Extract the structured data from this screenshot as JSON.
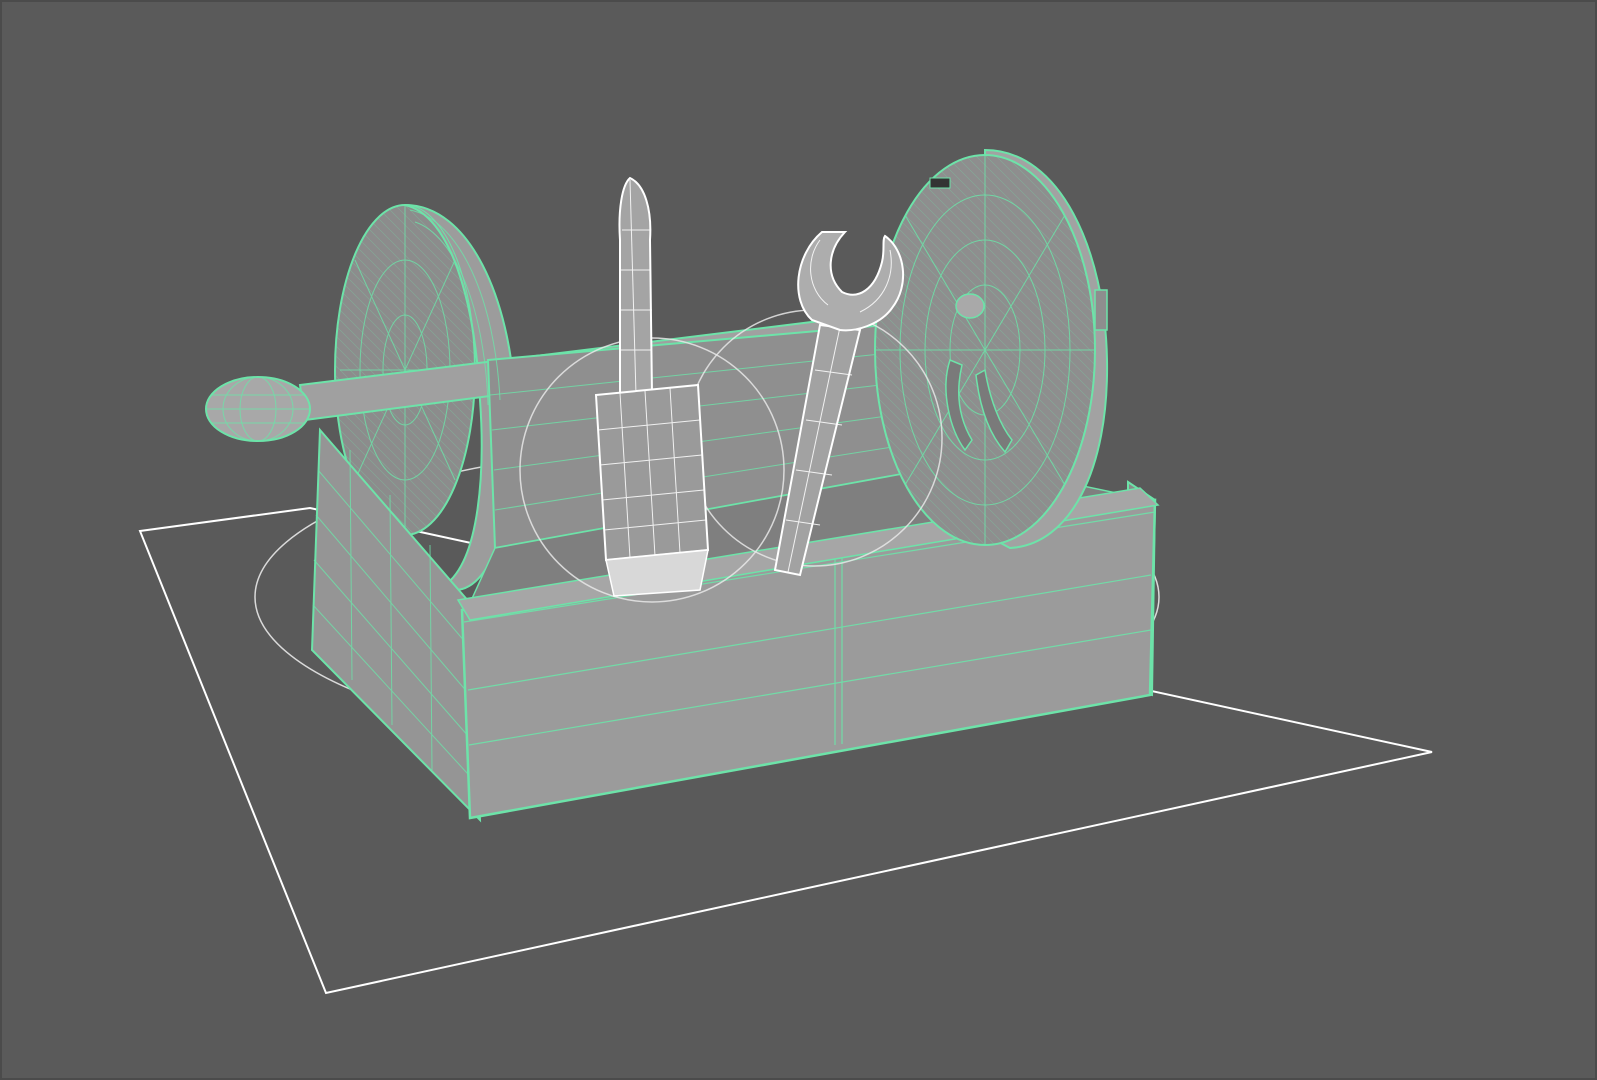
{
  "viewport": {
    "background": "#5a5a5a",
    "wire_selected_color": "#6de3a9",
    "wire_component_color": "#ffffff",
    "surface_color": "#9a9a9a",
    "surface_dark_color": "#858585"
  },
  "scene": {
    "objects": [
      "ground-plane",
      "selection-ellipse",
      "toolbox-body",
      "left-wheel",
      "right-wheel",
      "axle-handle",
      "screwdriver",
      "wrench",
      "manipulator-circle-left",
      "manipulator-circle-right"
    ]
  }
}
